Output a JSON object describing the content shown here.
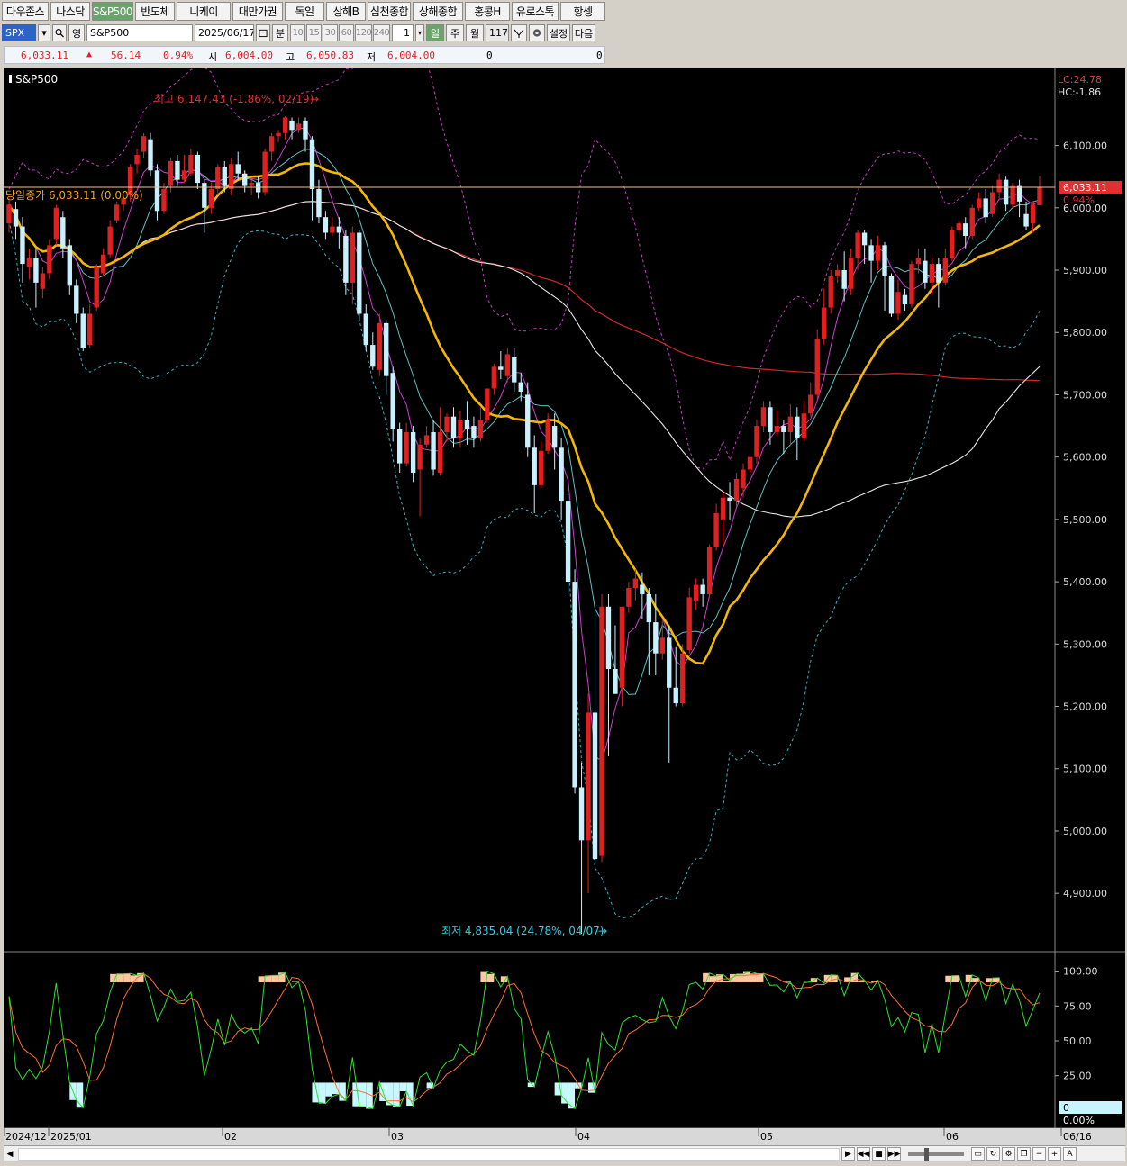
{
  "tabs": [
    {
      "label": "다우존스",
      "w": 52
    },
    {
      "label": "나스닥",
      "w": 44
    },
    {
      "label": "S&P500",
      "w": 46,
      "active": true
    },
    {
      "label": "반도체",
      "w": 44
    },
    {
      "label": "니케이",
      "w": 60
    },
    {
      "label": "대만가권",
      "w": 56
    },
    {
      "label": "독일",
      "w": 44
    },
    {
      "label": "상해B",
      "w": 44
    },
    {
      "label": "심천종합",
      "w": 48
    },
    {
      "label": "상해종합",
      "w": 56
    },
    {
      "label": "홍콩H",
      "w": 50
    },
    {
      "label": "유로스톡",
      "w": 52
    },
    {
      "label": "항셍",
      "w": 50
    }
  ],
  "controls": {
    "symbol_code": "SPX",
    "period_label": "영",
    "symbol_name": "S&P500",
    "date": "2025/06/17",
    "unit_label": "분",
    "intervals": [
      "10",
      "15",
      "30",
      "60",
      "120",
      "240"
    ],
    "count": "1",
    "day_label": "일",
    "week_label": "주",
    "month_label": "월",
    "bars": "117",
    "settings_label": "설정",
    "next_label": "다음"
  },
  "quote": {
    "last": "6,033.11",
    "arrow": "▲",
    "change": "56.14",
    "change_pct": "0.94%",
    "open_label": "시",
    "open": "6,004.00",
    "high_label": "고",
    "high": "6,050.83",
    "low_label": "저",
    "low": "6,004.00",
    "volume": "0",
    "amount": "0"
  },
  "chart_data": {
    "type": "candlestick",
    "title": "S&P500",
    "right_info": {
      "lc": "LC:24.78",
      "hc": "HC:-1.86"
    },
    "y_ticks": [
      "6,100.00",
      "6,000.00",
      "5,900.00",
      "5,800.00",
      "5,700.00",
      "5,600.00",
      "5,500.00",
      "5,400.00",
      "5,300.00",
      "5,200.00",
      "5,100.00",
      "5,000.00",
      "4,900.00"
    ],
    "ylim": [
      4815,
      6215
    ],
    "last_price_label": "6,033.11",
    "last_pct_label": "0.94%",
    "current_close_label": "당일종가 6,033.11 (0.00%)",
    "high_annotation": "최고 6,147.43 (-1.86%, 02/19)",
    "low_annotation": "최저 4,835.04 (24.78%, 04/07)",
    "x_labels": [
      "2024/12",
      "2025/01",
      "02",
      "03",
      "04",
      "05",
      "06",
      "06/16"
    ],
    "candles": [
      [
        5975,
        6005,
        5960,
        6015
      ],
      [
        5998,
        5970,
        5950,
        6010
      ],
      [
        5970,
        5910,
        5880,
        5985
      ],
      [
        5905,
        5920,
        5885,
        5935
      ],
      [
        5920,
        5880,
        5840,
        5935
      ],
      [
        5870,
        5895,
        5855,
        5905
      ],
      [
        5895,
        5940,
        5885,
        5950
      ],
      [
        5950,
        6000,
        5940,
        6005
      ],
      [
        5985,
        5935,
        5920,
        5995
      ],
      [
        5940,
        5875,
        5860,
        5950
      ],
      [
        5875,
        5830,
        5815,
        5885
      ],
      [
        5830,
        5775,
        5770,
        5840
      ],
      [
        5780,
        5830,
        5775,
        5845
      ],
      [
        5840,
        5905,
        5835,
        5910
      ],
      [
        5895,
        5925,
        5890,
        5935
      ],
      [
        5925,
        5970,
        5920,
        5980
      ],
      [
        5980,
        6005,
        5975,
        6010
      ],
      [
        6005,
        6015,
        5995,
        6020
      ],
      [
        6020,
        6065,
        6010,
        6070
      ],
      [
        6070,
        6085,
        6055,
        6095
      ],
      [
        6090,
        6115,
        6080,
        6120
      ],
      [
        6110,
        6060,
        6050,
        6120
      ],
      [
        6060,
        5995,
        5980,
        6070
      ],
      [
        5995,
        6030,
        5990,
        6040
      ],
      [
        6035,
        6075,
        6025,
        6080
      ],
      [
        6075,
        6045,
        6035,
        6085
      ],
      [
        6045,
        6060,
        6040,
        6085
      ],
      [
        6055,
        6085,
        6050,
        6095
      ],
      [
        6085,
        6040,
        6030,
        6090
      ],
      [
        6040,
        6000,
        5960,
        6045
      ],
      [
        6000,
        6030,
        5990,
        6040
      ],
      [
        6030,
        6065,
        6020,
        6070
      ],
      [
        6065,
        6035,
        6025,
        6075
      ],
      [
        6030,
        6070,
        6020,
        6080
      ],
      [
        6070,
        6055,
        6045,
        6090
      ],
      [
        6055,
        6035,
        6025,
        6060
      ],
      [
        6035,
        6040,
        6020,
        6045
      ],
      [
        6040,
        6025,
        6015,
        6050
      ],
      [
        6025,
        6090,
        6020,
        6095
      ],
      [
        6090,
        6115,
        6075,
        6120
      ],
      [
        6115,
        6120,
        6105,
        6125
      ],
      [
        6120,
        6145,
        6110,
        6147
      ],
      [
        6140,
        6125,
        6110,
        6145
      ],
      [
        6125,
        6135,
        6120,
        6145
      ],
      [
        6140,
        6110,
        6090,
        6145
      ],
      [
        6110,
        6030,
        5980,
        6115
      ],
      [
        6030,
        5985,
        5975,
        6045
      ],
      [
        5985,
        5960,
        5950,
        5995
      ],
      [
        5960,
        5970,
        5955,
        5985
      ],
      [
        5970,
        5960,
        5935,
        5985
      ],
      [
        5955,
        5880,
        5860,
        5965
      ],
      [
        5880,
        5960,
        5845,
        5970
      ],
      [
        5960,
        5830,
        5820,
        5965
      ],
      [
        5830,
        5780,
        5770,
        5845
      ],
      [
        5780,
        5745,
        5740,
        5800
      ],
      [
        5740,
        5815,
        5730,
        5830
      ],
      [
        5815,
        5730,
        5700,
        5820
      ],
      [
        5735,
        5645,
        5625,
        5745
      ],
      [
        5645,
        5590,
        5575,
        5655
      ],
      [
        5590,
        5640,
        5585,
        5655
      ],
      [
        5640,
        5575,
        5560,
        5650
      ],
      [
        5580,
        5620,
        5505,
        5630
      ],
      [
        5620,
        5635,
        5615,
        5650
      ],
      [
        5640,
        5580,
        5570,
        5660
      ],
      [
        5575,
        5640,
        5570,
        5680
      ],
      [
        5640,
        5665,
        5625,
        5670
      ],
      [
        5665,
        5630,
        5615,
        5680
      ],
      [
        5630,
        5660,
        5615,
        5675
      ],
      [
        5660,
        5645,
        5620,
        5690
      ],
      [
        5650,
        5630,
        5615,
        5665
      ],
      [
        5630,
        5660,
        5625,
        5680
      ],
      [
        5660,
        5710,
        5655,
        5710
      ],
      [
        5710,
        5745,
        5700,
        5750
      ],
      [
        5745,
        5740,
        5725,
        5770
      ],
      [
        5730,
        5765,
        5720,
        5775
      ],
      [
        5760,
        5720,
        5705,
        5775
      ],
      [
        5720,
        5705,
        5690,
        5735
      ],
      [
        5700,
        5615,
        5600,
        5720
      ],
      [
        5615,
        5555,
        5510,
        5635
      ],
      [
        5555,
        5610,
        5550,
        5625
      ],
      [
        5610,
        5660,
        5605,
        5670
      ],
      [
        5650,
        5615,
        5580,
        5670
      ],
      [
        5615,
        5530,
        5500,
        5630
      ],
      [
        5530,
        5400,
        5380,
        5540
      ],
      [
        5400,
        5070,
        5060,
        5420
      ],
      [
        5070,
        4985,
        4835,
        5110
      ],
      [
        4985,
        5190,
        4900,
        5220
      ],
      [
        5190,
        4955,
        4945,
        5360
      ],
      [
        4960,
        5360,
        4950,
        5380
      ],
      [
        5360,
        5260,
        5120,
        5380
      ],
      [
        5260,
        5220,
        5220,
        5330
      ],
      [
        5230,
        5360,
        5200,
        5360
      ],
      [
        5360,
        5390,
        5350,
        5400
      ],
      [
        5390,
        5405,
        5370,
        5420
      ],
      [
        5395,
        5380,
        5340,
        5415
      ],
      [
        5380,
        5335,
        5250,
        5390
      ],
      [
        5335,
        5285,
        5250,
        5380
      ],
      [
        5285,
        5310,
        5275,
        5340
      ],
      [
        5310,
        5230,
        5110,
        5330
      ],
      [
        5230,
        5205,
        5200,
        5295
      ],
      [
        5205,
        5285,
        5200,
        5300
      ],
      [
        5290,
        5375,
        5285,
        5390
      ],
      [
        5370,
        5395,
        5355,
        5405
      ],
      [
        5395,
        5380,
        5360,
        5405
      ],
      [
        5380,
        5455,
        5375,
        5460
      ],
      [
        5455,
        5510,
        5450,
        5525
      ],
      [
        5500,
        5535,
        5460,
        5545
      ],
      [
        5535,
        5530,
        5500,
        5560
      ],
      [
        5530,
        5565,
        5520,
        5575
      ],
      [
        5550,
        5580,
        5535,
        5590
      ],
      [
        5580,
        5600,
        5575,
        5600
      ],
      [
        5600,
        5650,
        5590,
        5660
      ],
      [
        5650,
        5680,
        5640,
        5690
      ],
      [
        5680,
        5640,
        5620,
        5690
      ],
      [
        5640,
        5650,
        5635,
        5675
      ],
      [
        5650,
        5640,
        5605,
        5660
      ],
      [
        5640,
        5665,
        5620,
        5685
      ],
      [
        5665,
        5630,
        5595,
        5680
      ],
      [
        5630,
        5670,
        5625,
        5690
      ],
      [
        5670,
        5700,
        5665,
        5720
      ],
      [
        5700,
        5790,
        5690,
        5805
      ],
      [
        5790,
        5840,
        5780,
        5870
      ],
      [
        5840,
        5890,
        5830,
        5900
      ],
      [
        5890,
        5900,
        5880,
        5910
      ],
      [
        5900,
        5870,
        5850,
        5930
      ],
      [
        5870,
        5920,
        5860,
        5935
      ],
      [
        5920,
        5960,
        5900,
        5965
      ],
      [
        5960,
        5940,
        5910,
        5965
      ],
      [
        5940,
        5915,
        5880,
        5950
      ],
      [
        5915,
        5940,
        5900,
        5955
      ],
      [
        5940,
        5890,
        5835,
        5945
      ],
      [
        5890,
        5830,
        5825,
        5895
      ],
      [
        5830,
        5865,
        5820,
        5885
      ],
      [
        5860,
        5845,
        5835,
        5870
      ],
      [
        5845,
        5910,
        5840,
        5915
      ],
      [
        5910,
        5920,
        5895,
        5935
      ],
      [
        5915,
        5880,
        5870,
        5935
      ],
      [
        5880,
        5910,
        5860,
        5920
      ],
      [
        5910,
        5880,
        5840,
        5920
      ],
      [
        5880,
        5920,
        5875,
        5935
      ],
      [
        5920,
        5965,
        5915,
        5970
      ],
      [
        5965,
        5975,
        5960,
        5980
      ],
      [
        5975,
        5955,
        5935,
        5985
      ],
      [
        5955,
        6000,
        5950,
        6005
      ],
      [
        6000,
        6015,
        5995,
        6025
      ],
      [
        6015,
        5985,
        5975,
        6030
      ],
      [
        5990,
        6025,
        5985,
        6035
      ],
      [
        6025,
        6045,
        6015,
        6055
      ],
      [
        6045,
        6005,
        5995,
        6050
      ],
      [
        6005,
        6035,
        6000,
        6040
      ],
      [
        6035,
        6010,
        5985,
        6045
      ],
      [
        5990,
        5970,
        5965,
        6010
      ],
      [
        5975,
        6005,
        5960,
        6010
      ],
      [
        6004,
        6033,
        6004,
        6051
      ]
    ],
    "osc_ticks": [
      "100.00",
      "75.00",
      "50.00",
      "25.00"
    ],
    "osc_ylim": [
      -12,
      112
    ],
    "osc_badge_top": "0",
    "osc_badge_bottom": "0.00%"
  }
}
